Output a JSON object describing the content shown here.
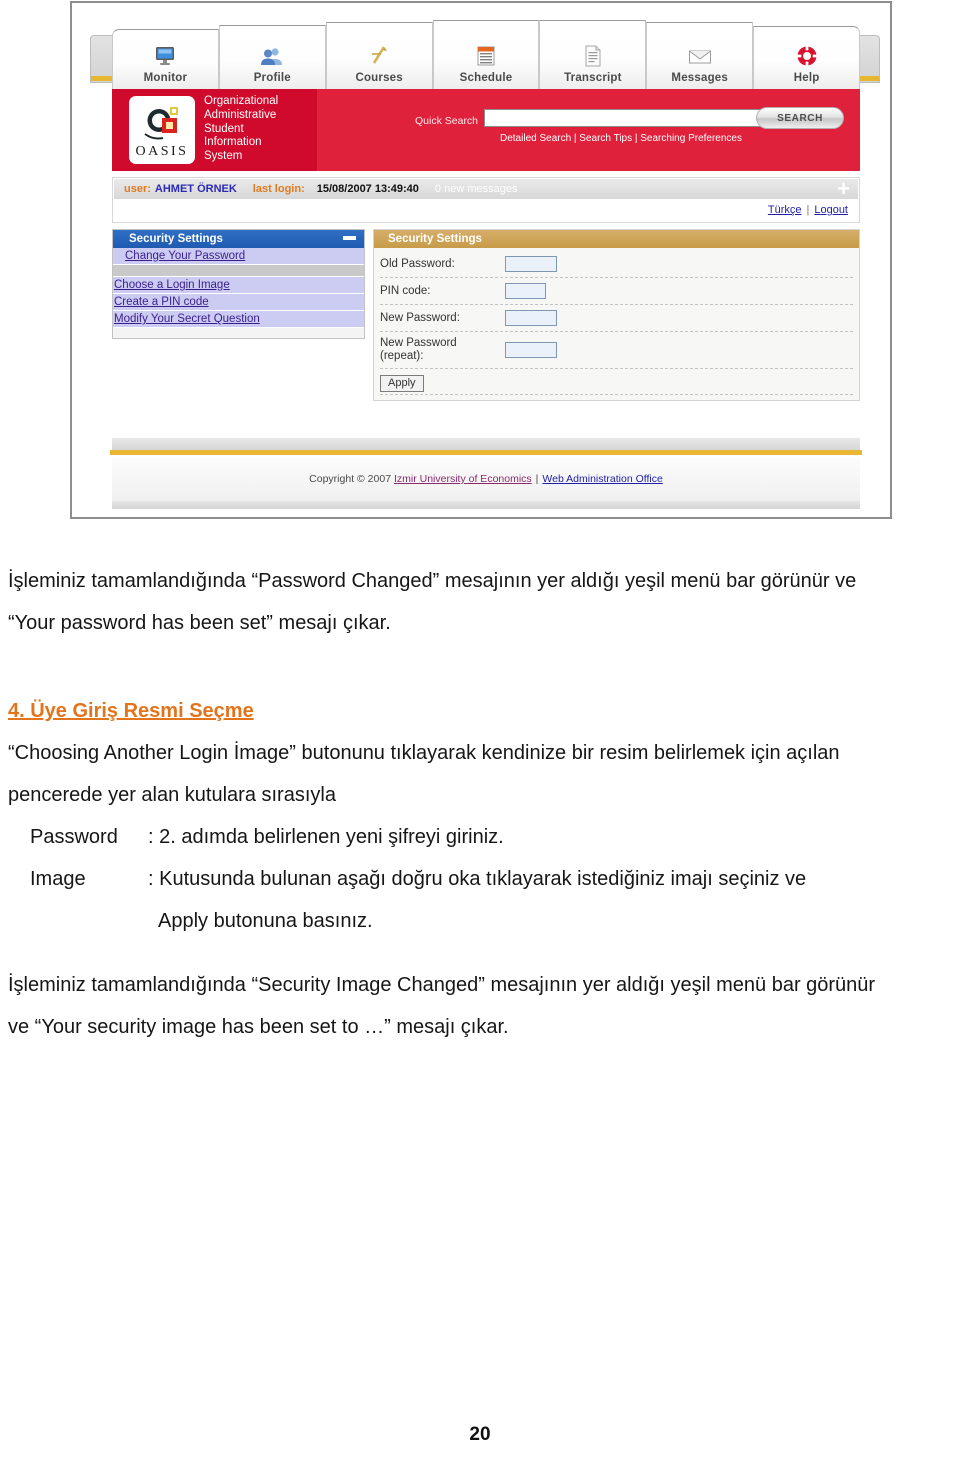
{
  "screenshot": {
    "tabs": [
      {
        "label": "Monitor",
        "icon": "monitor-icon"
      },
      {
        "label": "Profile",
        "icon": "people-icon"
      },
      {
        "label": "Courses",
        "icon": "pen-icon"
      },
      {
        "label": "Schedule",
        "icon": "calendar-icon"
      },
      {
        "label": "Transcript",
        "icon": "document-icon"
      },
      {
        "label": "Messages",
        "icon": "envelope-icon"
      },
      {
        "label": "Help",
        "icon": "lifebuoy-icon"
      }
    ],
    "brand": {
      "logo_word": "OASIS",
      "system_name": "Organizational\nAdministrative\nStudent\nInformation\nSystem"
    },
    "search": {
      "label": "Quick Search",
      "value": "",
      "placeholder": "",
      "button_label": "SEARCH",
      "links": "Detailed Search | Search Tips | Searching Preferences"
    },
    "userbar": {
      "user_key": "user:",
      "user_name": "AHMET ÖRNEK",
      "lastlogin_key": "last login:",
      "lastlogin_value": "15/08/2007 13:49:40",
      "messages": "0 new messages",
      "expand_icon": "plus-icon",
      "language_link": "Türkçe",
      "separator": "|",
      "logout_link": "Logout"
    },
    "left_panel": {
      "title": "Security Settings",
      "collapse_icon": "minus-icon",
      "items": [
        {
          "label": "Change Your Password"
        },
        {
          "label": "Choose a Login Image"
        },
        {
          "label": "Create a PIN code"
        },
        {
          "label": "Modify Your Secret Question"
        }
      ]
    },
    "right_panel": {
      "title": "Security Settings",
      "collapse_icon": "minus-icon",
      "fields": [
        {
          "label": "Old Password:",
          "value": ""
        },
        {
          "label": "PIN code:",
          "value": ""
        },
        {
          "label": "New Password:",
          "value": ""
        },
        {
          "label": "New Password\n(repeat):",
          "value": ""
        }
      ],
      "apply_label": "Apply"
    },
    "footer": {
      "copyright": "Copyright © 2007",
      "university_link": "Izmir University of Economics",
      "separator": "|",
      "office_link": "Web Administration Office"
    },
    "colors": {
      "brand_red": "#e0213c",
      "brand_red_dark": "#cf0a2c",
      "panel_blue": "#1f5bb0",
      "panel_gold": "#c89b48",
      "menu_lilac": "#ccccf2",
      "accent_gold_rule": "#e9b733"
    }
  },
  "document": {
    "paragraph_1": "İşleminiz tamamlandığında “Password Changed” mesajının yer aldığı yeşil menü bar görünür ve “Your password has been set” mesajı çıkar.",
    "paragraph_1_line1": "İşleminiz tamamlandığında “Password Changed” mesajının yer aldığı yeşil menü bar görünür ve",
    "paragraph_1_line2": "“Your password has been set” mesajı çıkar.",
    "heading_4": "4. Üye Giriş Resmi Seçme",
    "paragraph_2_line1": "“Choosing Another Login İmage” butonunu tıklayarak kendinize bir resim belirlemek için açılan",
    "paragraph_2_line2": "pencerede yer alan kutulara sırasıyla",
    "field_rows": [
      {
        "key": "Password",
        "value": ": 2. adımda belirlenen yeni şifreyi giriniz."
      },
      {
        "key": "Image",
        "value": ": Kutusunda bulunan aşağı doğru oka tıklayarak istediğiniz imajı seçiniz ve"
      },
      {
        "key": "",
        "value": "Apply butonuna basınız."
      }
    ],
    "paragraph_3_line1": "İşleminiz tamamlandığında “Security Image Changed” mesajının yer aldığı yeşil menü bar görünür",
    "paragraph_3_line2": "ve “Your security image has been set to …” mesajı çıkar.",
    "page_number": "20"
  }
}
